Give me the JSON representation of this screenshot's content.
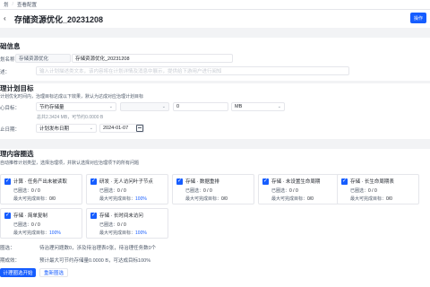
{
  "breadcrumb": {
    "parent": "划",
    "current": "查看配置"
  },
  "header": {
    "title": "存储资源优化_20231208",
    "operate_label": "操作"
  },
  "basic": {
    "title": "础信息",
    "name_label": "划名称：",
    "name_prefix": "存储资源优化",
    "name_value": "存储资源优化_20231208",
    "desc_label": "述：",
    "desc_placeholder": "输入计划描述类文本，该内容将在计划详情及消息中展示，提供给下游用户进行阅知"
  },
  "target": {
    "title": "理计划目标",
    "desc": "计划优化时间内，治理目标达成以下效果，默认为达成对应治理计划目标",
    "core_label": "心目标：",
    "metric_select": "节约存储量",
    "op_placeholder": "",
    "value": "0",
    "unit": "MB",
    "stats": "总共2.3424 MB，可节约0.0000 B",
    "end_label": "止日期：",
    "end_mode": "计划发布日期",
    "end_date": "2024-01-07"
  },
  "content": {
    "title": "理内容圈选",
    "desc": "自动推荐计划类型，选择治理项，并默认选择对应治理项下的所有问题",
    "cards": [
      {
        "type": "计算",
        "name": "任务产出未被读取",
        "selected_label": "已圈选：",
        "selected": "0 / 0",
        "max_label": "最大可完成目标：",
        "max": "0/0"
      },
      {
        "type": "研发",
        "name": "无人访问叶子节点",
        "selected_label": "已圈选：",
        "selected": "0 / 0",
        "max_label": "最大可完成目标：",
        "max": "100%"
      },
      {
        "type": "存储",
        "name": "数据重排",
        "selected_label": "已圈选：",
        "selected": "0 / 0",
        "max_label": "最大可完成目标：",
        "max": "0/0"
      },
      {
        "type": "存储",
        "name": "未设置生命周期",
        "selected_label": "已圈选：",
        "selected": "0 / 0",
        "max_label": "最大可完成目标：",
        "max": "0/0"
      },
      {
        "type": "存储",
        "name": "长生命周期表",
        "selected_label": "已圈选：",
        "selected": "0 / 0",
        "max_label": "最大可完成目标：",
        "max": "0/0"
      },
      {
        "type": "存储",
        "name": "简单复制",
        "selected_label": "已圈选：",
        "selected": "0 / 0",
        "max_label": "最大可完成目标：",
        "max": "100%"
      },
      {
        "type": "存储",
        "name": "长时间未访问",
        "selected_label": "已圈选：",
        "selected": "0 / 0",
        "max_label": "最大可完成目标：",
        "max": "100%"
      }
    ],
    "selected_label": "圈选：",
    "selected_text": "待治理问题数0，涉及待治理表0张，待治理任务数0个",
    "effect_label": "期成效：",
    "effect_text": "预计最大可节约存储量0.0000 B，可达成目标100%"
  },
  "actions": {
    "primary": "计理圈选开始",
    "reset": "重新圈选"
  }
}
